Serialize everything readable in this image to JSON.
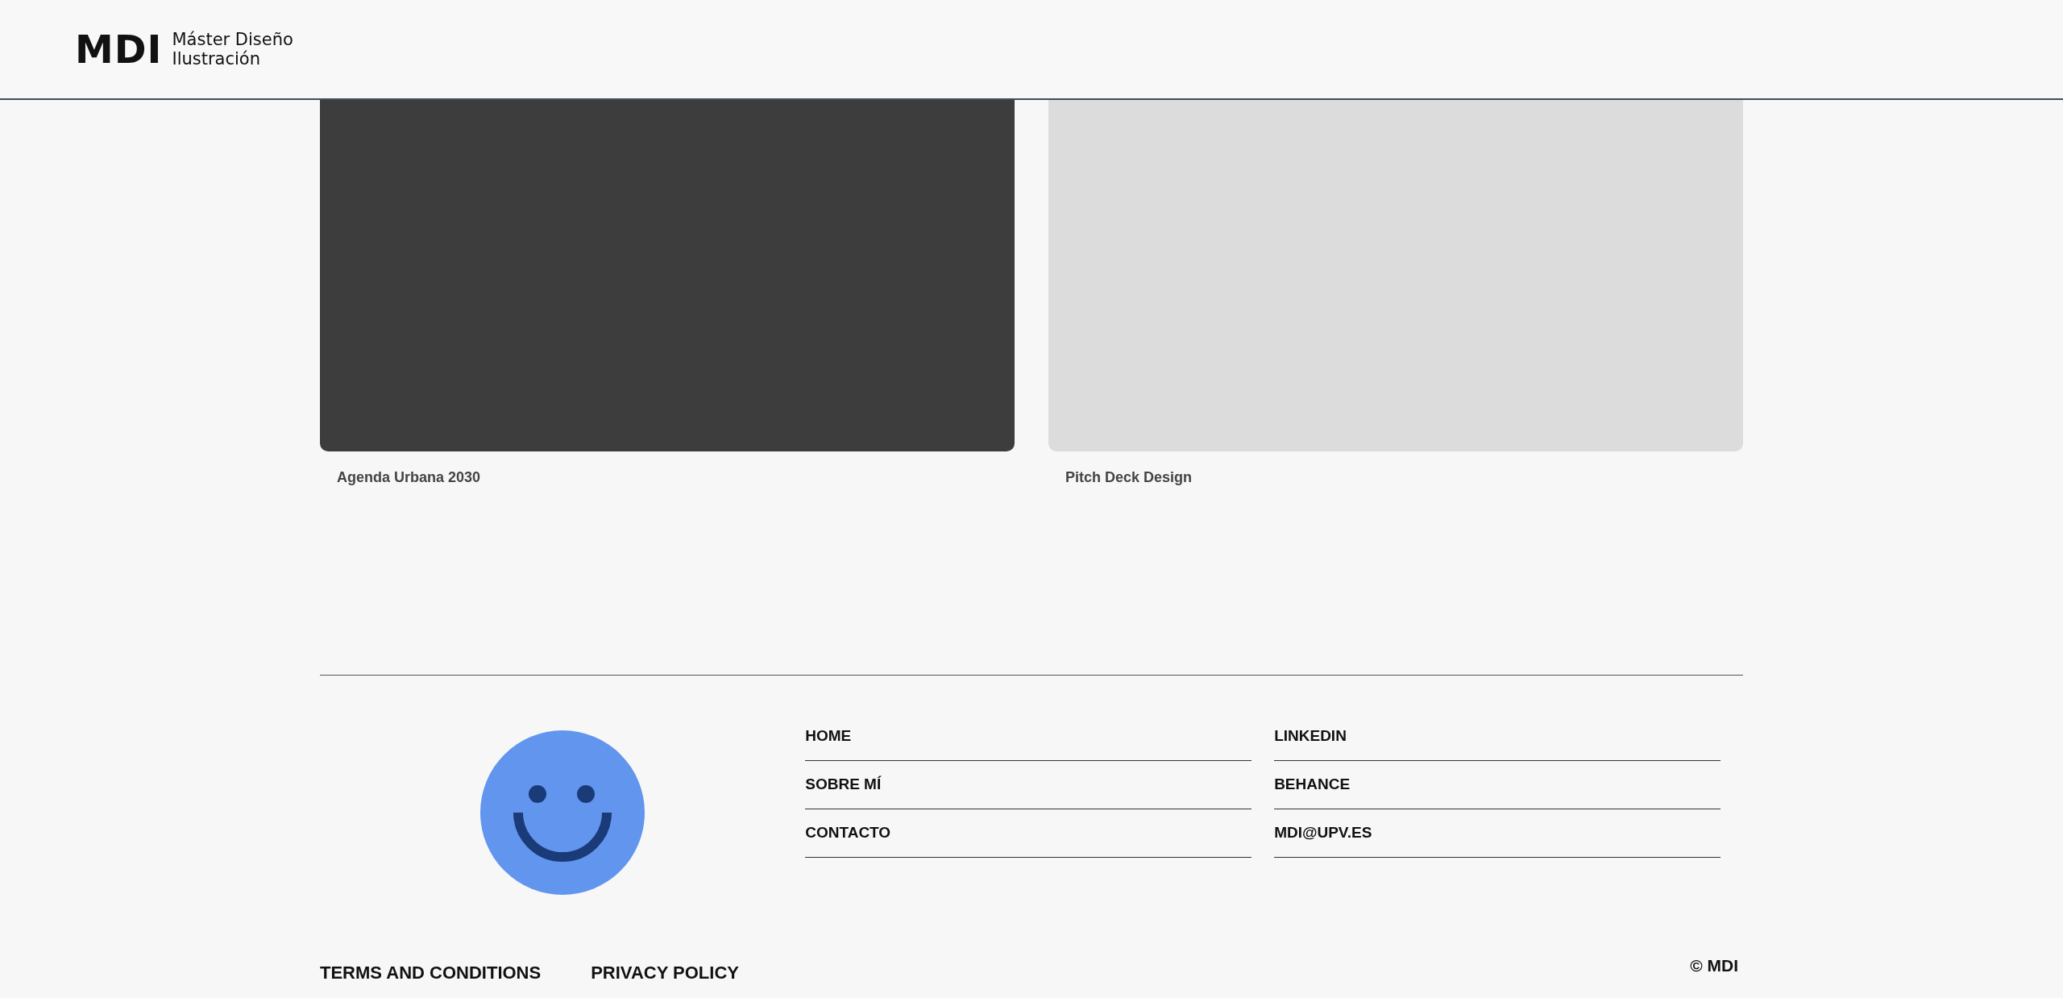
{
  "header": {
    "logo": "MDI",
    "subtitle": [
      "Máster Diseño",
      "Ilustración"
    ]
  },
  "projects": [
    {
      "caption": "Agenda Urbana 2030",
      "color": "#3d3d3d"
    },
    {
      "caption": "Pitch Deck Design",
      "color": "#dcdcdc"
    }
  ],
  "footer": {
    "nav_links": [
      "HOME",
      "SOBRE MÍ",
      "CONTACTO"
    ],
    "contact_links": [
      "LINKEDIN",
      "BEHANCE",
      "MDI@UPV.ES"
    ],
    "legal_links": [
      "TERMS AND CONDITIONS",
      "PRIVACY POLICY"
    ],
    "copyright": "© MDI"
  }
}
